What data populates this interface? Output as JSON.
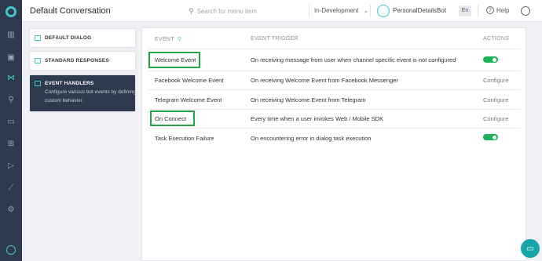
{
  "header": {
    "title": "Default Conversation",
    "search_placeholder": "Search for menu item",
    "status": "In-Development",
    "bot_name": "PersonalDetailsBot",
    "language": "En",
    "help_label": "Help"
  },
  "sidebar": {
    "items": [
      {
        "label": "DEFAULT DIALOG"
      },
      {
        "label": "STANDARD RESPONSES"
      },
      {
        "label": "EVENT HANDLERS",
        "description": "Configure various bot events by defining custom behavior."
      }
    ]
  },
  "table": {
    "headers": {
      "event": "EVENT",
      "trigger": "EVENT TRIGGER",
      "actions": "ACTIONS"
    },
    "rows": [
      {
        "event": "Welcome Event",
        "trigger": "On receiving message from user when channel specific event is not configured",
        "action": "toggle-on"
      },
      {
        "event": "Facebook Welcome Event",
        "trigger": "On receiving Welcome Event from Facebook Messenger",
        "action": "Configure"
      },
      {
        "event": "Telegram Welcome Event",
        "trigger": "On receiving Welcome Event from Telegram",
        "action": "Configure"
      },
      {
        "event": "On Connect",
        "trigger": "Every time when a user invokes Web / Mobile SDK",
        "action": "Configure"
      },
      {
        "event": "Task Execution Failure",
        "trigger": "On encountering error in dialog task execution",
        "action": "toggle-on"
      }
    ]
  },
  "colors": {
    "accent": "#3fc8c8",
    "toggle_on": "#1fb15a",
    "highlight": "#22a447",
    "rail": "#2e3b4e"
  }
}
